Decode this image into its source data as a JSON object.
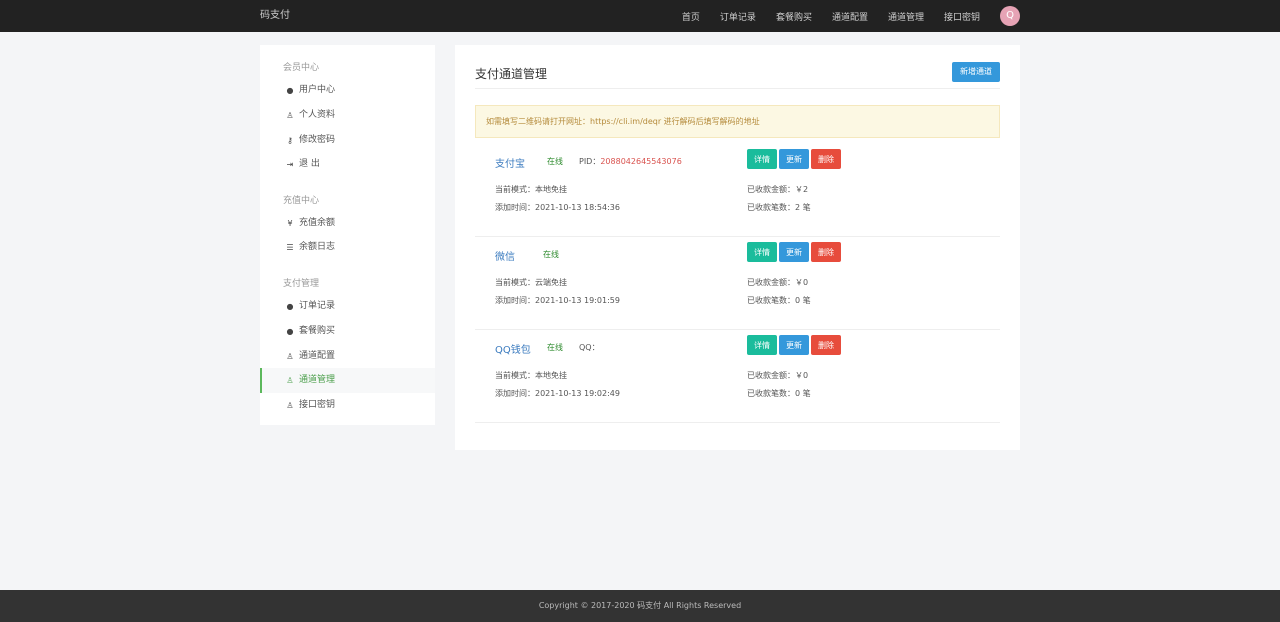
{
  "brand": "码支付",
  "nav": [
    "首页",
    "订单记录",
    "套餐购买",
    "通道配置",
    "通道管理",
    "接口密钥"
  ],
  "avatar_letter": "Q",
  "sidebar": {
    "sections": [
      "会员中心",
      "充值中心",
      "支付管理"
    ],
    "items": [
      {
        "label": "用户中心",
        "icon": "user-circle-icon",
        "glyph": "●"
      },
      {
        "label": "个人资料",
        "icon": "user-icon",
        "glyph": "♙"
      },
      {
        "label": "修改密码",
        "icon": "key-icon",
        "glyph": "⚷"
      },
      {
        "label": "退 出",
        "icon": "sign-out-icon",
        "glyph": "⇥"
      },
      {
        "label": "充值余额",
        "icon": "yen-icon",
        "glyph": "¥"
      },
      {
        "label": "余额日志",
        "icon": "list-icon",
        "glyph": "☰"
      },
      {
        "label": "订单记录",
        "icon": "user-circle-icon",
        "glyph": "●"
      },
      {
        "label": "套餐购买",
        "icon": "user-circle-icon",
        "glyph": "●"
      },
      {
        "label": "通道配置",
        "icon": "user-icon",
        "glyph": "♙"
      },
      {
        "label": "通道管理",
        "icon": "user-icon",
        "glyph": "♙"
      },
      {
        "label": "接口密钥",
        "icon": "user-icon",
        "glyph": "♙"
      }
    ]
  },
  "main": {
    "title": "支付通道管理",
    "new_button": "新增通道",
    "notice": "如需填写二维码请打开网址：https://cli.im/deqr 进行解码后填写解码的地址",
    "buttons": {
      "detail": "详情",
      "update": "更新",
      "delete": "删除"
    },
    "channels": [
      {
        "name": "支付宝",
        "status": "在线",
        "id_label": "PID：",
        "id_value": "2088042645543076",
        "mode": "当前模式：本地免挂",
        "time": "添加时间：2021-10-13 18:54:36",
        "amount": "已收款金额：￥2",
        "count": "已收款笔数：2 笔"
      },
      {
        "name": "微信",
        "status": "在线",
        "id_label": "",
        "id_value": "",
        "mode": "当前模式：云端免挂",
        "time": "添加时间：2021-10-13 19:01:59",
        "amount": "已收款金额：￥0",
        "count": "已收款笔数：0 笔"
      },
      {
        "name": "QQ钱包",
        "status": "在线",
        "id_label": "QQ：",
        "id_value": "",
        "mode": "当前模式：本地免挂",
        "time": "添加时间：2021-10-13 19:02:49",
        "amount": "已收款金额：￥0",
        "count": "已收款笔数：0 笔"
      }
    ]
  },
  "footer": "Copyright © 2017-2020 码支付 All Rights Reserved"
}
